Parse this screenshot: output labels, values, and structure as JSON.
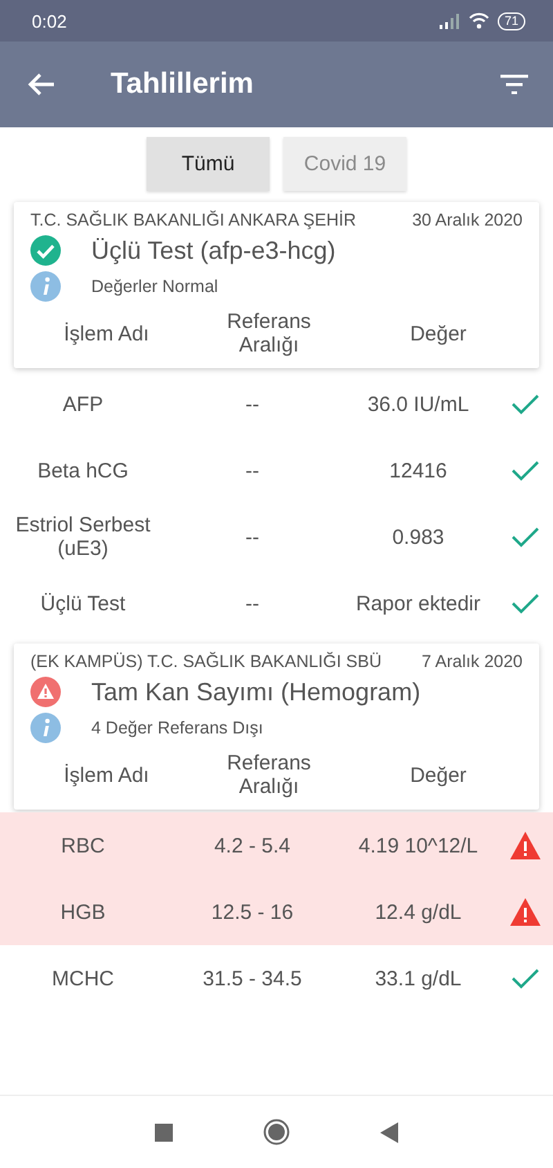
{
  "status_bar": {
    "time": "0:02",
    "battery": "71"
  },
  "app_bar": {
    "title": "Tahlillerim"
  },
  "tabs": [
    {
      "label": "Tümü",
      "selected": true
    },
    {
      "label": "Covid 19",
      "selected": false
    }
  ],
  "results": [
    {
      "hospital": "T.C. SAĞLIK BAKANLIĞI ANKARA ŞEHİR",
      "date": "30 Aralık 2020",
      "test": "Üçlü Test (afp-e3-hcg)",
      "kind": "normal",
      "summary": "Değerler Normal",
      "columns": [
        "İşlem Adı",
        "Referans Aralığı",
        "Değer"
      ],
      "rows": [
        {
          "name": "AFP",
          "reference": "--",
          "value": "36.0 IU/mL",
          "abnormal": false
        },
        {
          "name": "Beta hCG",
          "reference": "--",
          "value": "12416",
          "abnormal": false
        },
        {
          "name": "Estriol Serbest (uE3)",
          "reference": "--",
          "value": "0.983",
          "abnormal": false
        },
        {
          "name": "Üçlü Test",
          "reference": "--",
          "value": "Rapor ektedir",
          "abnormal": false
        }
      ]
    },
    {
      "hospital": "(EK KAMPÜS) T.C. SAĞLIK BAKANLIĞI SBÜ",
      "date": "7 Aralık 2020",
      "test": "Tam Kan Sayımı (Hemogram)",
      "kind": "alert",
      "summary": "4 Değer Referans Dışı",
      "columns": [
        "İşlem Adı",
        "Referans Aralığı",
        "Değer"
      ],
      "rows": [
        {
          "name": "RBC",
          "reference": "4.2 - 5.4",
          "value": "4.19 10^12/L",
          "abnormal": true
        },
        {
          "name": "HGB",
          "reference": "12.5 - 16",
          "value": "12.4 g/dL",
          "abnormal": true
        },
        {
          "name": "MCHC",
          "reference": "31.5 - 34.5",
          "value": "33.1 g/dL",
          "abnormal": false
        }
      ]
    }
  ]
}
